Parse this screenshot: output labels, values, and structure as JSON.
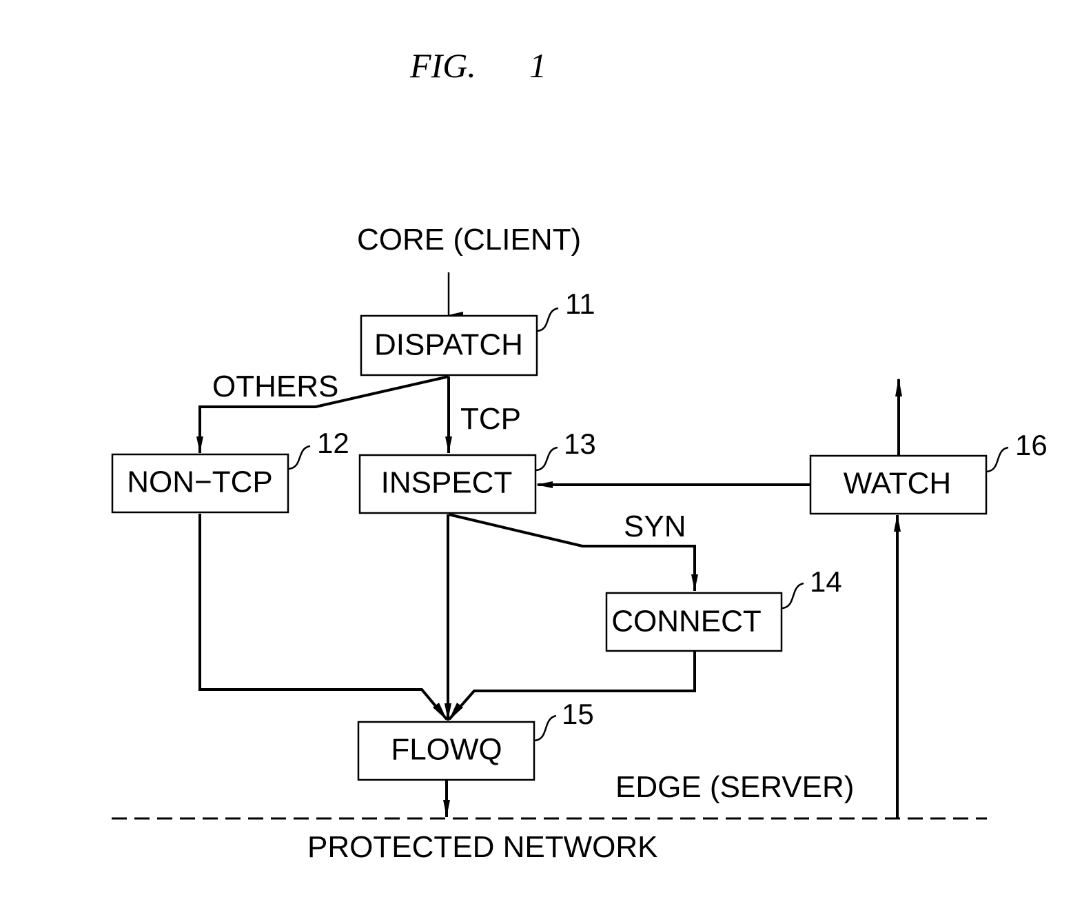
{
  "figure": {
    "title": "FIG.",
    "number": "1"
  },
  "labels": {
    "top": "CORE (CLIENT)",
    "others": "OTHERS",
    "tcp": "TCP",
    "syn": "SYN",
    "edge": "EDGE (SERVER)",
    "bottom": "PROTECTED NETWORK"
  },
  "blocks": [
    {
      "id": "dispatch",
      "label": "DISPATCH",
      "ref": "11"
    },
    {
      "id": "non-tcp",
      "label": "NON−TCP",
      "ref": "12"
    },
    {
      "id": "inspect",
      "label": "INSPECT",
      "ref": "13"
    },
    {
      "id": "connect",
      "label": "CONNECT",
      "ref": "14"
    },
    {
      "id": "flowq",
      "label": "FLOWQ",
      "ref": "15"
    },
    {
      "id": "watch",
      "label": "WATCH",
      "ref": "16"
    }
  ]
}
